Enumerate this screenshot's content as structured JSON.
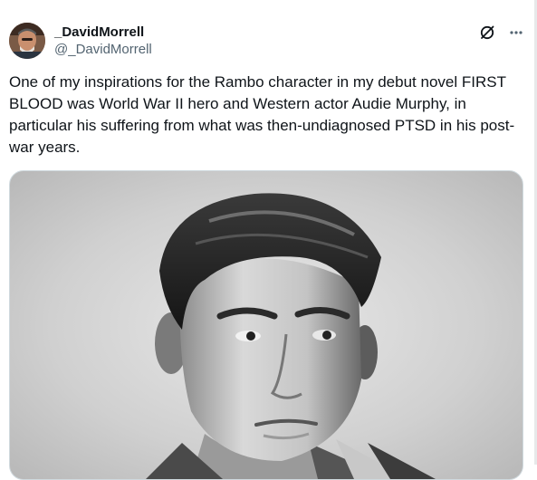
{
  "tweet": {
    "author": {
      "display_name": "_DavidMorrell",
      "handle": "@_DavidMorrell"
    },
    "text": "One of my inspirations for the Rambo character in my debut novel FIRST BLOOD was World War II hero and Western actor Audie Murphy, in particular his suffering from what was then-undiagnosed PTSD in his post-war years.",
    "media": {
      "kind": "black-and-white portrait photograph"
    },
    "icons": {
      "grok": "grok-icon",
      "more": "more-icon"
    }
  }
}
